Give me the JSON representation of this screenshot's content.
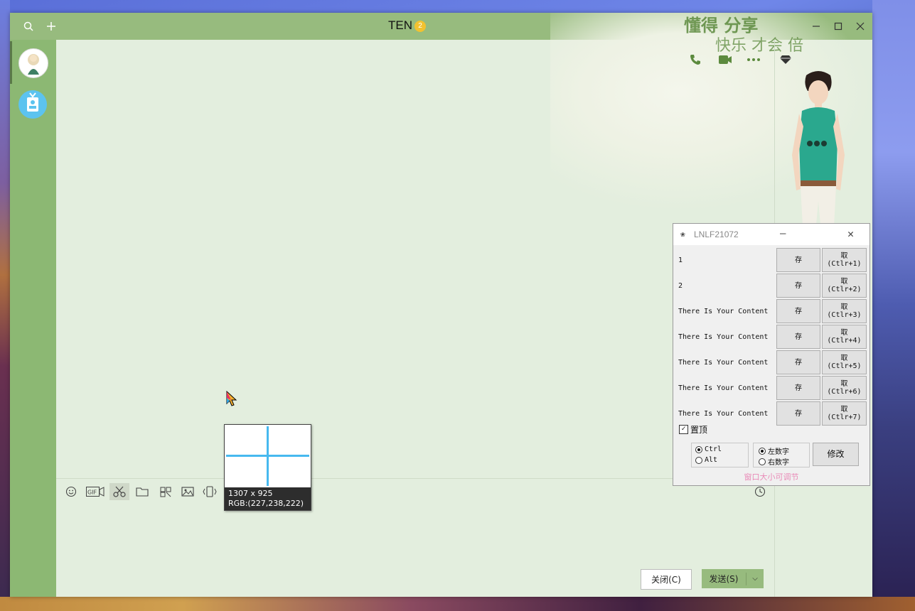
{
  "chat": {
    "title": "TEN",
    "title_badge": "2",
    "slogan_top": "懂得 分享",
    "slogan_bottom": "快乐 才会 倍",
    "close_label": "关闭(C)",
    "send_label": "发送(S)"
  },
  "capture": {
    "size": "1307 x 925",
    "rgb": "RGB:(227,238,222)"
  },
  "tool": {
    "title": "LNLF21072",
    "rows": [
      {
        "label": "1",
        "save": "存",
        "get": "取\n(Ctlr+1)"
      },
      {
        "label": "2",
        "save": "存",
        "get": "取\n(Ctlr+2)"
      },
      {
        "label": "There Is Your Content",
        "save": "存",
        "get": "取\n(Ctlr+3)"
      },
      {
        "label": "There Is Your Content",
        "save": "存",
        "get": "取\n(Ctlr+4)"
      },
      {
        "label": "There Is Your Content",
        "save": "存",
        "get": "取\n(Ctlr+5)"
      },
      {
        "label": "There Is Your Content",
        "save": "存",
        "get": "取\n(Ctlr+6)"
      },
      {
        "label": "There Is Your Content",
        "save": "存",
        "get": "取\n(Ctlr+7)"
      }
    ],
    "pin_label": "置顶",
    "modifier_ctrl": "Ctrl",
    "modifier_alt": "Alt",
    "keypad_left": "左数字",
    "keypad_right": "右数字",
    "modify_label": "修改",
    "footer": "窗口大小可调节"
  },
  "colors": {
    "titlebar": "#97bb7e",
    "sidebar": "#8cb873",
    "chat_bg": "#e3eede",
    "capture_crosshair": "#47b9ef"
  }
}
